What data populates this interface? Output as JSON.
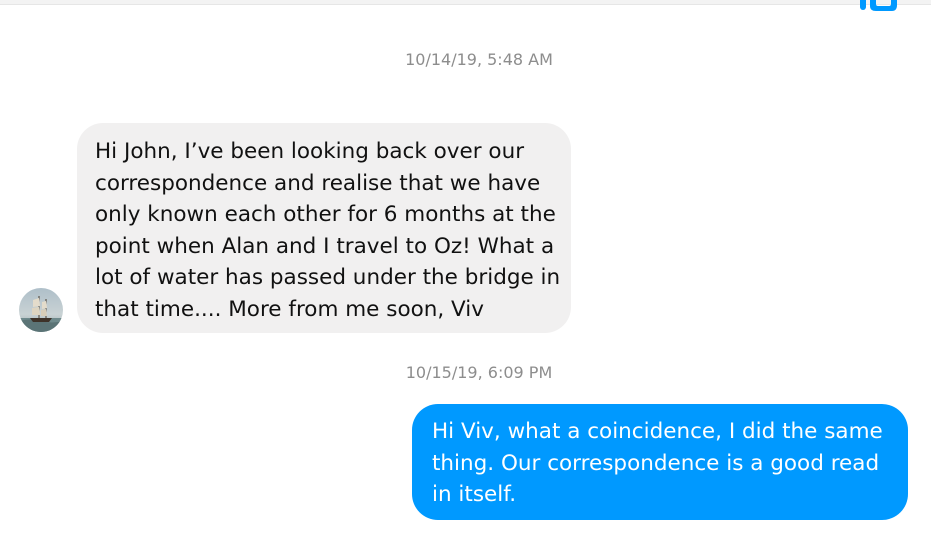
{
  "icons": {
    "top_right": "messenger-logo-icon",
    "avatar": "sailing-ship-avatar"
  },
  "colors": {
    "outgoing_bubble": "#0099ff",
    "incoming_bubble": "#f1f0f0",
    "timestamp": "#8d8d8d"
  },
  "thread": {
    "messages": [
      {
        "timestamp": "10/14/19, 5:48 AM",
        "direction": "incoming",
        "lines": [
          "Hi John, I’ve been looking back over our",
          "correspondence and realise that we have",
          "only known each other for 6 months at the",
          "point when Alan and I travel to Oz! What a",
          "lot of water has passed under the bridge in",
          "that time.... More from me soon, Viv"
        ]
      },
      {
        "timestamp": "10/15/19, 6:09 PM",
        "direction": "outgoing",
        "lines": [
          "Hi Viv, what a coincidence,  I did the same",
          "thing. Our correspondence  is a good read",
          "in itself."
        ]
      }
    ]
  }
}
